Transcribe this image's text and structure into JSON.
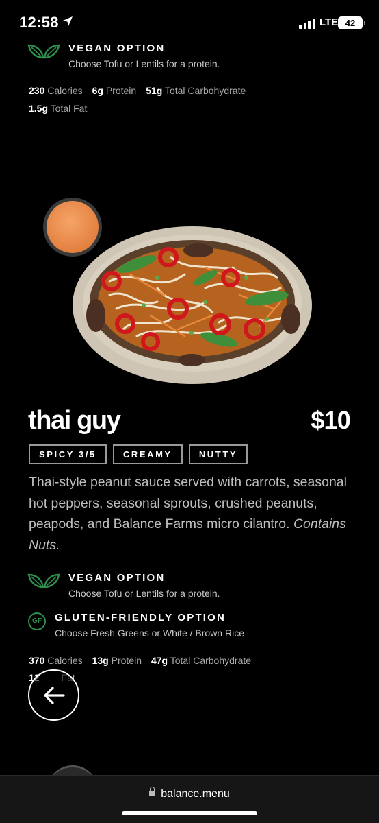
{
  "status_bar": {
    "time": "12:58",
    "network": "LTE",
    "battery": "42"
  },
  "top_item": {
    "vegan": {
      "title": "VEGAN OPTION",
      "desc": "Choose Tofu or Lentils for a protein."
    },
    "nutrition": {
      "calories_value": "230",
      "calories_label": "Calories",
      "protein_value": "6g",
      "protein_label": "Protein",
      "carb_value": "51g",
      "carb_label": "Total Carbohydrate",
      "fat_value": "1.5g",
      "fat_label": "Total Fat"
    }
  },
  "item": {
    "name": "thai guy",
    "price": "$10",
    "tags": [
      "SPICY 3/5",
      "CREAMY",
      "NUTTY"
    ],
    "description": "Thai-style peanut sauce served with carrots, seasonal hot peppers, seasonal sprouts, crushed peanuts, peapods, and Balance Farms micro cilantro. ",
    "description_note": "Contains Nuts.",
    "vegan": {
      "title": "VEGAN OPTION",
      "desc": "Choose Tofu or Lentils for a protein."
    },
    "gluten": {
      "badge": "GF",
      "title": "GLUTEN-FRIENDLY OPTION",
      "desc": "Choose Fresh Greens or White / Brown Rice"
    },
    "nutrition": {
      "calories_value": "370",
      "calories_label": "Calories",
      "protein_value": "13g",
      "protein_label": "Protein",
      "carb_value": "47g",
      "carb_label": "Total Carbohydrate",
      "fat_value": "12",
      "fat_label": "Fat"
    }
  },
  "browser": {
    "url": "balance.menu"
  },
  "colors": {
    "accent_green": "#2f8f4e",
    "background": "#000000"
  }
}
